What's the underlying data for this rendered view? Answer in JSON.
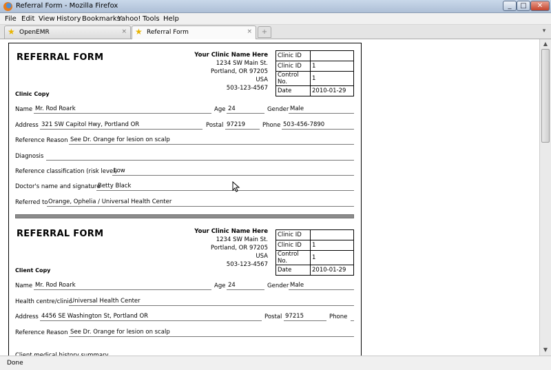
{
  "window": {
    "title": "Referral Form - Mozilla Firefox",
    "min": "_",
    "max": "□",
    "close": "✕"
  },
  "menu": [
    "File",
    "Edit",
    "View",
    "History",
    "Bookmarks",
    "Yahoo!",
    "Tools",
    "Help"
  ],
  "tabs": [
    {
      "label": "OpenEMR",
      "close": "×"
    },
    {
      "label": "Referral Form",
      "close": "×"
    }
  ],
  "new_tab": "+",
  "status": "Done",
  "forms": [
    {
      "title": "REFERRAL FORM",
      "copy_label": "Clinic Copy",
      "clinic": {
        "name": "Your Clinic Name Here",
        "street": "1234 SW Main St.",
        "city": "Portland, OR 97205",
        "country": "USA",
        "phone": "503-123-4567"
      },
      "id_table": [
        {
          "k": "Clinic ID",
          "v": ""
        },
        {
          "k": "Clinic ID",
          "v": "1"
        },
        {
          "k": "Control No.",
          "v": "1"
        },
        {
          "k": "Date",
          "v": "2010-01-29"
        }
      ],
      "fields": {
        "name_label": "Name",
        "name": "Mr. Rod Roark",
        "age_label": "Age",
        "age": "24",
        "gender_label": "Gender",
        "gender": "Male",
        "address_label": "Address",
        "address": "321 SW Capitol Hwy, Portland OR",
        "postal_label": "Postal",
        "postal": "97219",
        "phone_label": "Phone",
        "phone": "503-456-7890",
        "reason_label": "Reference Reason",
        "reason": "See Dr. Orange for lesion on scalp",
        "diagnosis_label": "Diagnosis",
        "diagnosis": "",
        "risk_label": "Reference classification (risk level)",
        "risk": "Low",
        "doctor_label": "Doctor's name and signature",
        "doctor": "Betty Black",
        "referred_label": "Referred to",
        "referred": "Orange, Ophelia / Universal Health Center"
      }
    },
    {
      "title": "REFERRAL FORM",
      "copy_label": "Client Copy",
      "clinic": {
        "name": "Your Clinic Name Here",
        "street": "1234 SW Main St.",
        "city": "Portland, OR 97205",
        "country": "USA",
        "phone": "503-123-4567"
      },
      "id_table": [
        {
          "k": "Clinic ID",
          "v": ""
        },
        {
          "k": "Clinic ID",
          "v": "1"
        },
        {
          "k": "Control No.",
          "v": "1"
        },
        {
          "k": "Date",
          "v": "2010-01-29"
        }
      ],
      "fields": {
        "name_label": "Name",
        "name": "Mr. Rod Roark",
        "age_label": "Age",
        "age": "24",
        "gender_label": "Gender",
        "gender": "Male",
        "centre_label": "Health centre/clinic",
        "centre": "Universal Health Center",
        "address_label": "Address",
        "address": "4456 SE Washington St, Portland OR",
        "postal_label": "Postal",
        "postal": "97215",
        "phone_label": "Phone",
        "phone": "",
        "reason_label": "Reference Reason",
        "reason": "See Dr. Orange for lesion on scalp",
        "history_label": "Client medical history summary"
      }
    }
  ]
}
